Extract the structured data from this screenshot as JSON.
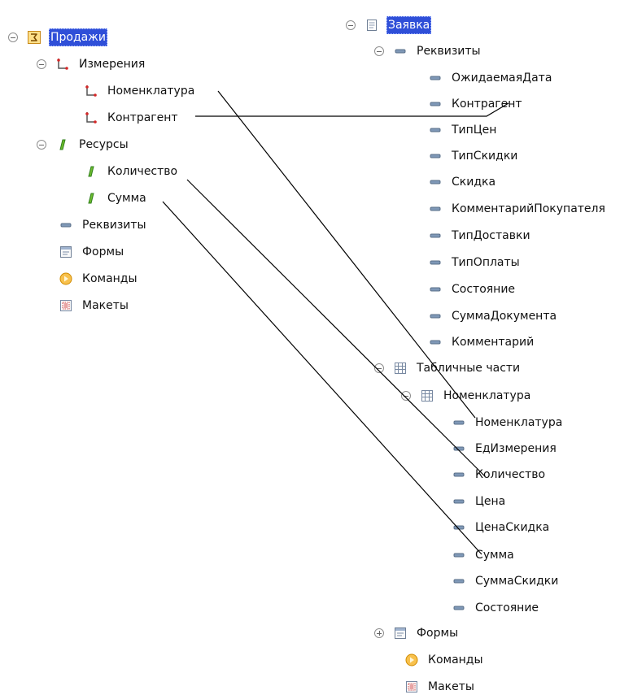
{
  "left_tree": {
    "root": "Продажи",
    "measurements_group": "Измерения",
    "measurements": [
      "Номенклатура",
      "Контрагент"
    ],
    "resources_group": "Ресурсы",
    "resources": [
      "Количество",
      "Сумма"
    ],
    "attributes": "Реквизиты",
    "forms": "Формы",
    "commands": "Команды",
    "layouts": "Макеты"
  },
  "right_tree": {
    "root": "Заявка",
    "attributes_group": "Реквизиты",
    "attributes": [
      "ОжидаемаяДата",
      "Контрагент",
      "ТипЦен",
      "ТипСкидки",
      "Скидка",
      "КомментарийПокупателя",
      "ТипДоставки",
      "ТипОплаты",
      "Состояние",
      "СуммаДокумента",
      "Комментарий"
    ],
    "tabular_sections_group": "Табличные части",
    "tabular_section_name": "Номенклатура",
    "tabular_fields": [
      "Номенклатура",
      "ЕдИзмерения",
      "Количество",
      "Цена",
      "ЦенаСкидка",
      "Сумма",
      "СуммаСкидки",
      "Состояние"
    ],
    "forms": "Формы",
    "commands": "Команды",
    "layouts": "Макеты"
  },
  "colors": {
    "selection": "#2f4fd8",
    "connector": "#000000"
  }
}
